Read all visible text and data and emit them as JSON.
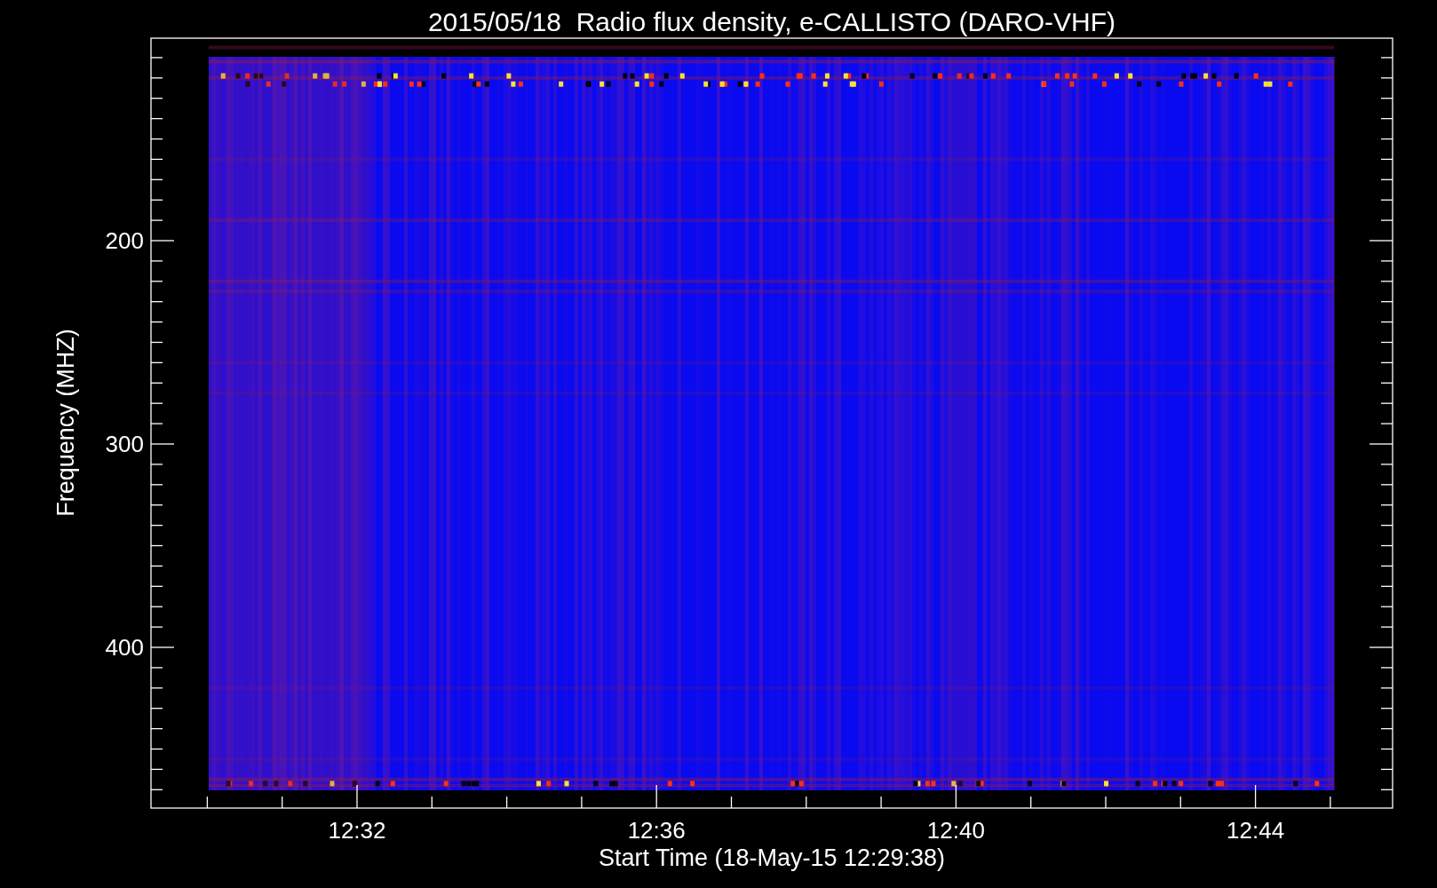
{
  "title": "2015/05/18  Radio flux density, e-CALLISTO (DARO-VHF)",
  "plot": {
    "ylabel": "Frequency (MHZ)",
    "xlabel": "Start Time (18-May-15 12:29:38)",
    "yticks": [
      "200",
      "300",
      "400"
    ],
    "xticks": [
      "12:32",
      "12:36",
      "12:40",
      "12:44"
    ]
  }
}
